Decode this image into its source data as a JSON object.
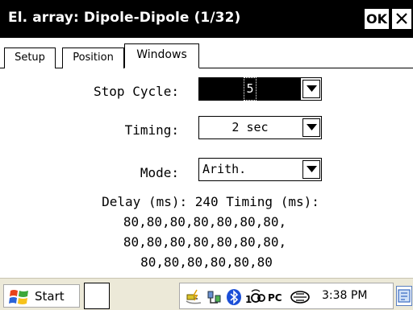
{
  "window": {
    "title": "El. array: Dipole-Dipole (1/32)",
    "ok_label": "OK",
    "close_icon": "close-icon"
  },
  "tabs": [
    {
      "label": "Setup",
      "active": false
    },
    {
      "label": "Position",
      "active": false
    },
    {
      "label": "Windows",
      "active": true
    }
  ],
  "form": {
    "stop_cycle": {
      "label": "Stop Cycle:",
      "value": "5"
    },
    "timing": {
      "label": "Timing:",
      "value": "2 sec"
    },
    "mode": {
      "label": "Mode:",
      "value": "Arith."
    }
  },
  "info": {
    "line1": "Delay (ms): 240 Timing (ms):",
    "line2": "80,80,80,80,80,80,80,",
    "line3": "80,80,80,80,80,80,80,",
    "line4": "80,80,80,80,80,80"
  },
  "taskbar": {
    "start_label": "Start",
    "tray_icons": [
      "power-plug-icon",
      "network-icon",
      "bluetooth-icon",
      "wireless-icon",
      "pc-connect-icon",
      "infrared-icon"
    ],
    "pc_label": "PC",
    "clock": "3:38 PM"
  },
  "colors": {
    "titlebar": "#000000",
    "taskbar": "#ece9d8",
    "highlight": "#000000"
  }
}
